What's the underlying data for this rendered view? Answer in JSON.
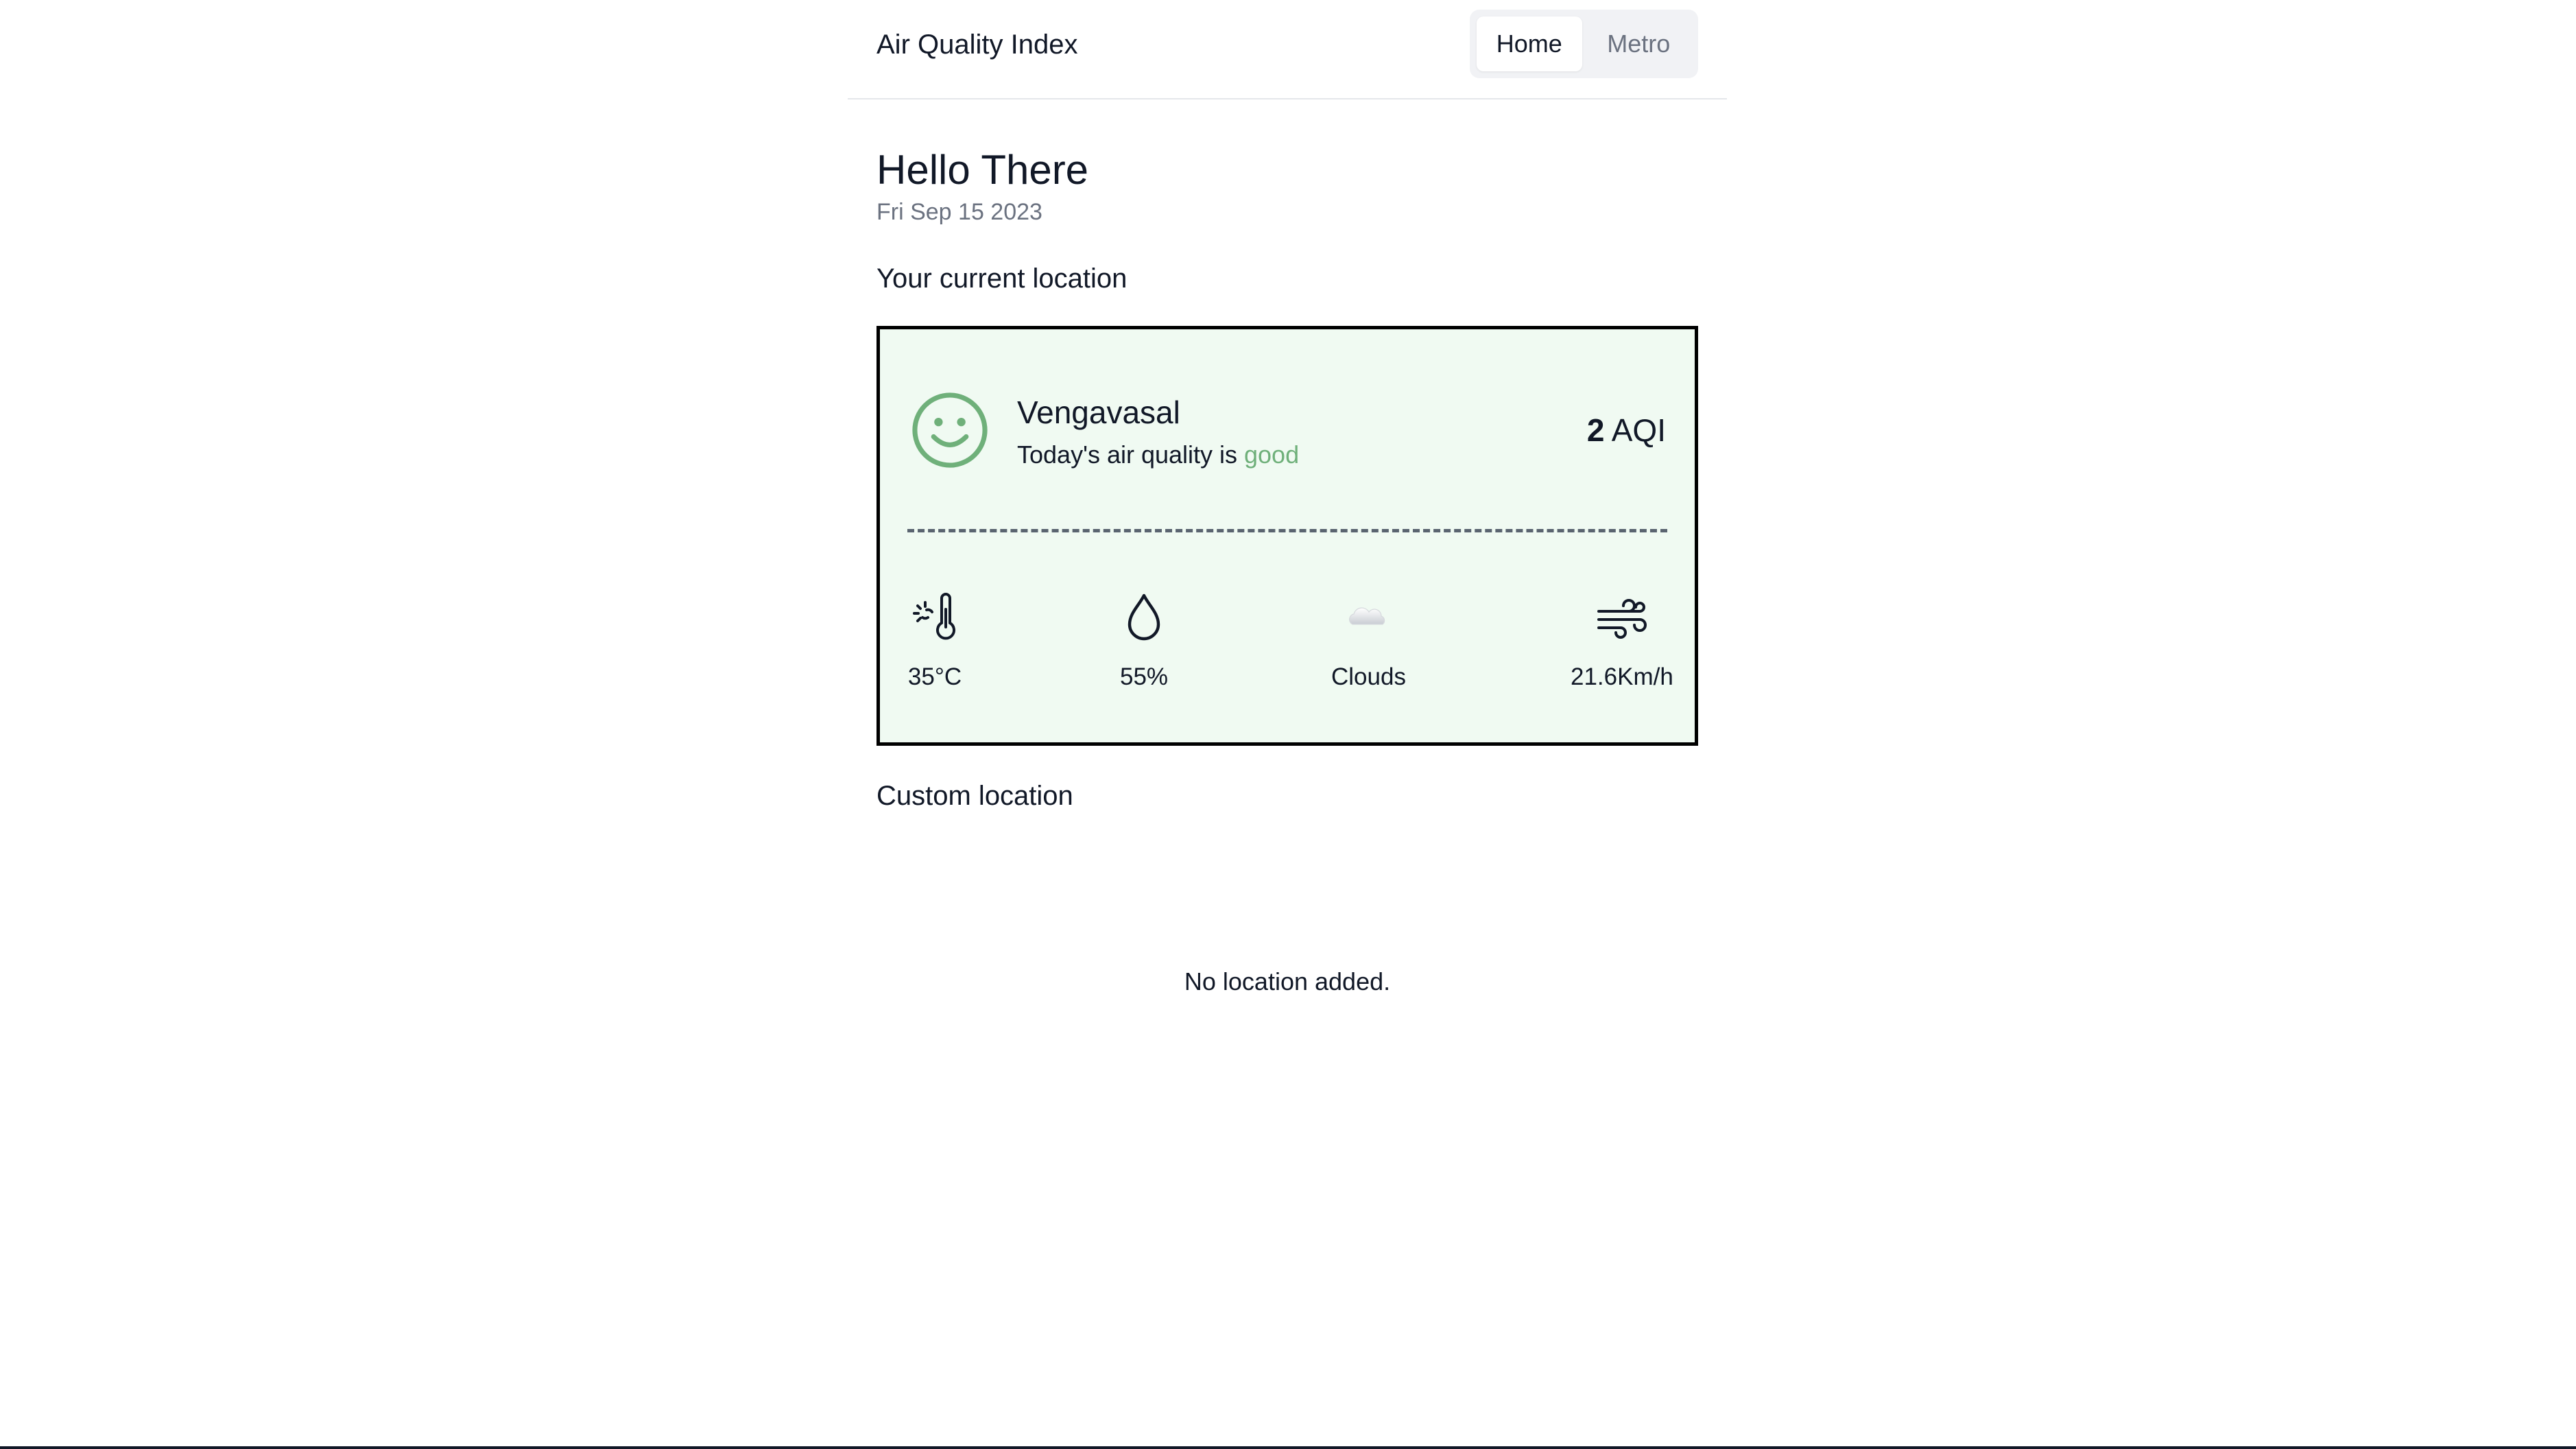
{
  "header": {
    "app_title": "Air Quality Index",
    "tabs": [
      {
        "label": "Home",
        "active": true
      },
      {
        "label": "Metro",
        "active": false
      }
    ]
  },
  "greeting": {
    "title": "Hello There",
    "date": "Fri Sep 15 2023"
  },
  "current_location": {
    "section_title": "Your current location",
    "city": "Vengavasal",
    "quality_prefix": "Today's air quality is ",
    "quality_word": "good",
    "aqi_value": "2",
    "aqi_unit": "AQI",
    "face_icon": "smiley-icon",
    "stats": {
      "temperature": "35°C",
      "humidity": "55%",
      "sky": "Clouds",
      "wind": "21.6Km/h"
    }
  },
  "custom_location": {
    "section_title": "Custom location",
    "empty_message": "No location added."
  },
  "colors": {
    "card_bg": "#f0faf2",
    "good": "#6fb07a",
    "border": "#000000"
  }
}
